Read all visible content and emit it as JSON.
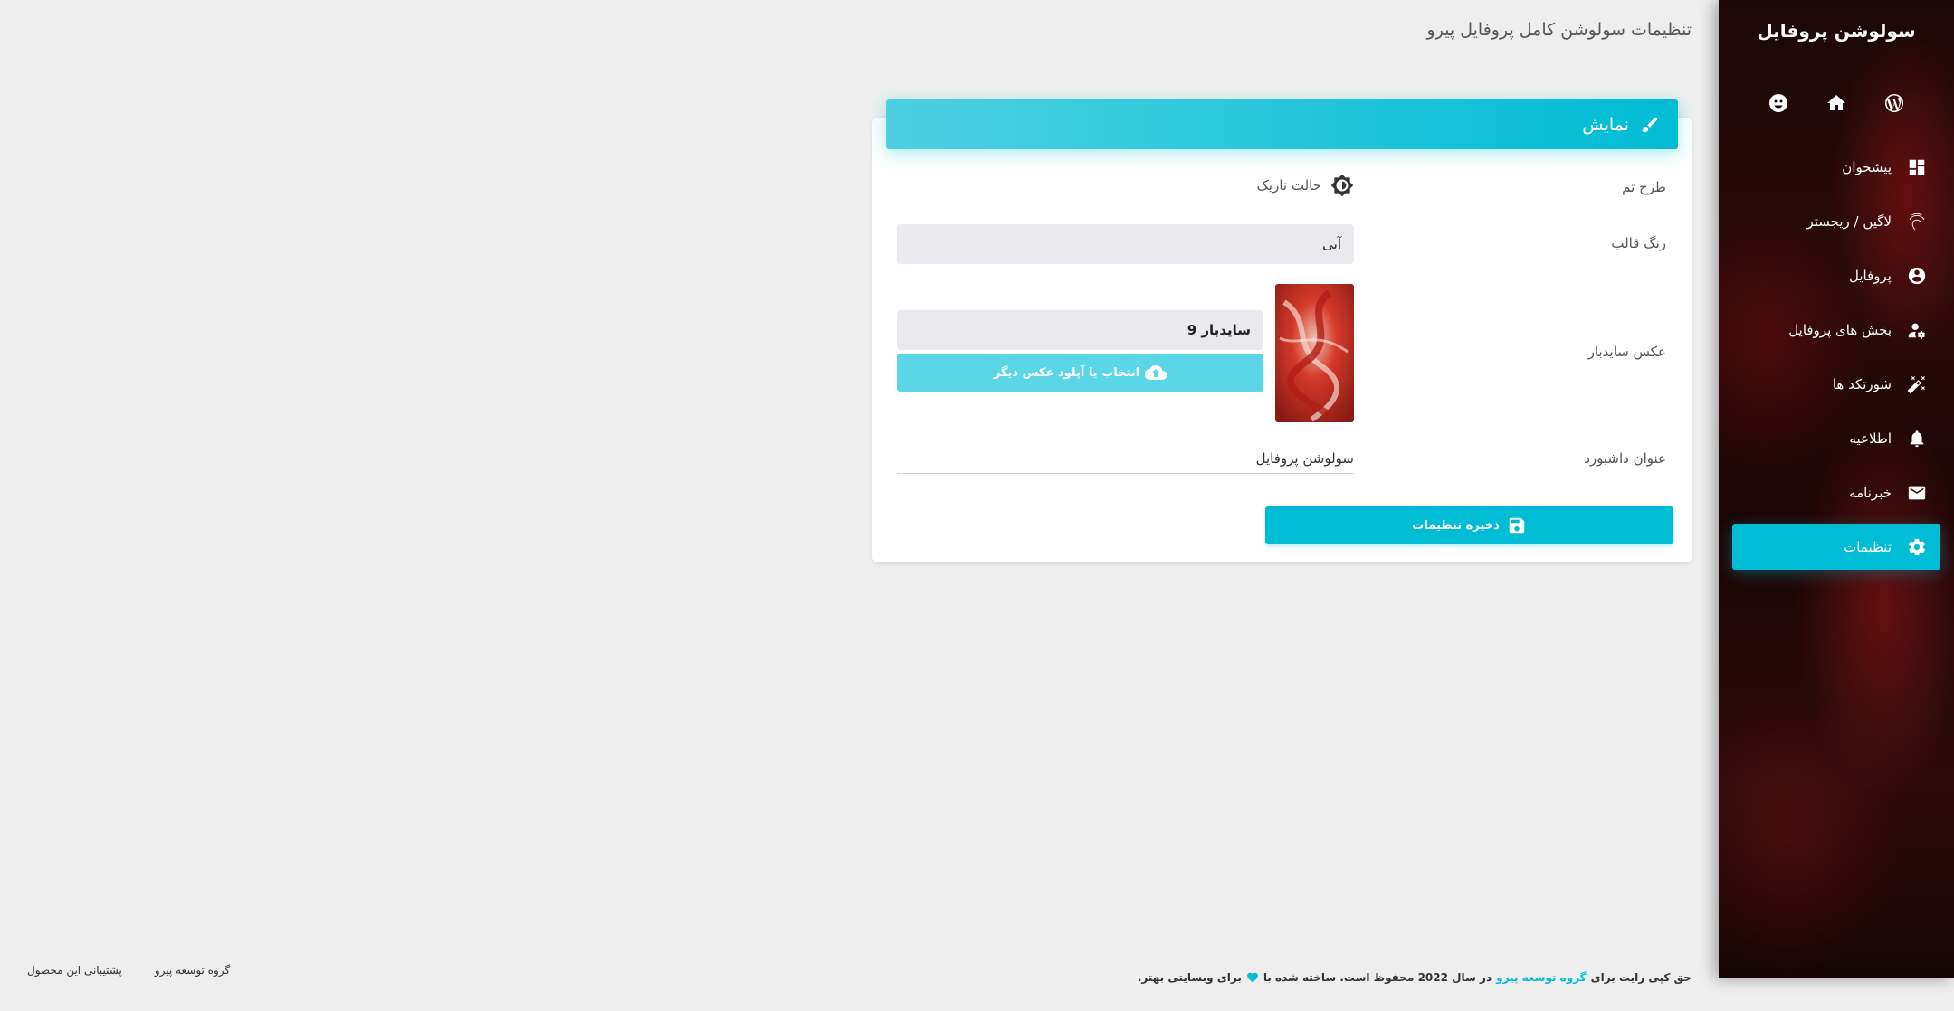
{
  "sidebar": {
    "brand": "سولوشن پروفایل",
    "quick_links": [
      {
        "icon": "wordpress-icon"
      },
      {
        "icon": "home-icon"
      },
      {
        "icon": "support-icon"
      }
    ],
    "items": [
      {
        "label": "پیشخوان",
        "icon": "dashboard-icon"
      },
      {
        "label": "لاگین / ریجستر",
        "icon": "fingerprint-icon"
      },
      {
        "label": "پروفایل",
        "icon": "account-circle-icon"
      },
      {
        "label": "بخش های پروفایل",
        "icon": "user-settings-icon"
      },
      {
        "label": "شورتکد ها",
        "icon": "magic-wand-icon"
      },
      {
        "label": "اطلاعیه",
        "icon": "bell-icon"
      },
      {
        "label": "خبرنامه",
        "icon": "mail-icon"
      },
      {
        "label": "تنظیمات",
        "icon": "gear-icon",
        "active": true
      }
    ],
    "active_color": "#00bcd4"
  },
  "header": {
    "title": "تنظیمات سولوشن کامل پروفایل پیرو"
  },
  "card": {
    "title": "نمایش",
    "theme_label": "طرح تم",
    "dark_mode_label": "حالت تاریک",
    "color_label": "رنگ قالب",
    "color_value": "آبی",
    "sidebar_image_label": "عکس سایدبار",
    "sidebar_image_value": "سایدبار 9",
    "upload_label": "انتخاب یا آپلود عکس دیگر",
    "dashboard_title_label": "عنوان داشبورد",
    "dashboard_title_value": "سولوشن پروفایل",
    "save_label": "ذخیره تنظیمات"
  },
  "footer": {
    "copyright_prefix": "حق کپی رایت برای",
    "copyright_brand": "گروه توسعه پیرو",
    "copyright_mid": "در سال 2022 محفوظ است. ساخته شده با",
    "copyright_suffix": "برای وبسایتی بهتر.",
    "links": [
      "گروه توسعه پیرو",
      "پشتیبانی این محصول"
    ]
  }
}
